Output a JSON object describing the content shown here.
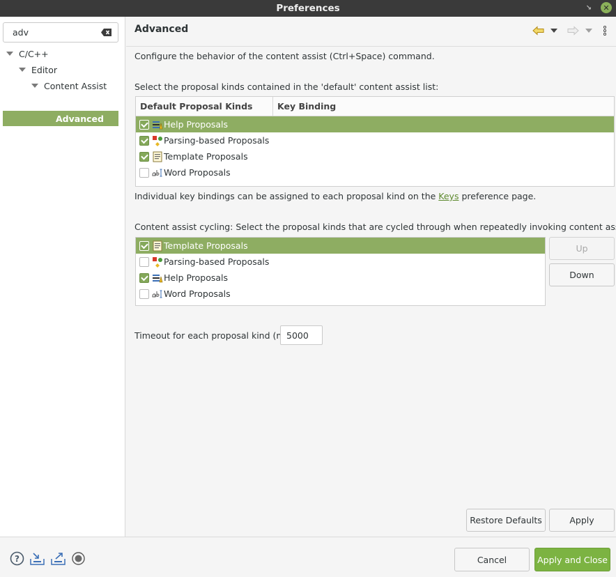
{
  "window": {
    "title": "Preferences"
  },
  "search": {
    "value": "adv",
    "placeholder": ""
  },
  "tree": {
    "items": [
      {
        "label": "C/C++"
      },
      {
        "label": "Editor"
      },
      {
        "label": "Content Assist"
      },
      {
        "label": "Advanced"
      }
    ]
  },
  "page": {
    "title": "Advanced",
    "description": "Configure the behavior of the content assist (Ctrl+Space) command.",
    "default_list_label": "Select the proposal kinds contained in the 'default' content assist list:",
    "table": {
      "headers": [
        "Default Proposal Kinds",
        "Key Binding"
      ],
      "rows": [
        {
          "label": "Help Proposals",
          "checked": true,
          "icon": "help-proposals-icon"
        },
        {
          "label": "Parsing-based Proposals",
          "checked": true,
          "icon": "parsing-proposals-icon"
        },
        {
          "label": "Template Proposals",
          "checked": true,
          "icon": "template-proposals-icon"
        },
        {
          "label": "Word Proposals",
          "checked": false,
          "icon": "word-proposals-icon"
        }
      ]
    },
    "keys_note_before": "Individual key bindings can be assigned to each proposal kind on the",
    "keys_link": "Keys",
    "keys_note_after": "preference page.",
    "cycling_label": "Content assist cycling: Select the proposal kinds that are cycled through when repeatedly invoking content assist:",
    "cycling_rows": [
      {
        "label": "Template Proposals",
        "checked": true
      },
      {
        "label": "Parsing-based Proposals",
        "checked": false
      },
      {
        "label": "Help Proposals",
        "checked": true
      },
      {
        "label": "Word Proposals",
        "checked": false
      }
    ],
    "up_label": "Up",
    "down_label": "Down",
    "timeout_label": "Timeout for each proposal kind (ms):",
    "timeout_value": "5000",
    "restore_label": "Restore Defaults",
    "apply_label": "Apply"
  },
  "footer": {
    "cancel_label": "Cancel",
    "apply_close_label": "Apply and Close"
  },
  "colors": {
    "accent": "#8ead62",
    "primary_button": "#7cb342",
    "titlebar": "#3a3a3a"
  }
}
